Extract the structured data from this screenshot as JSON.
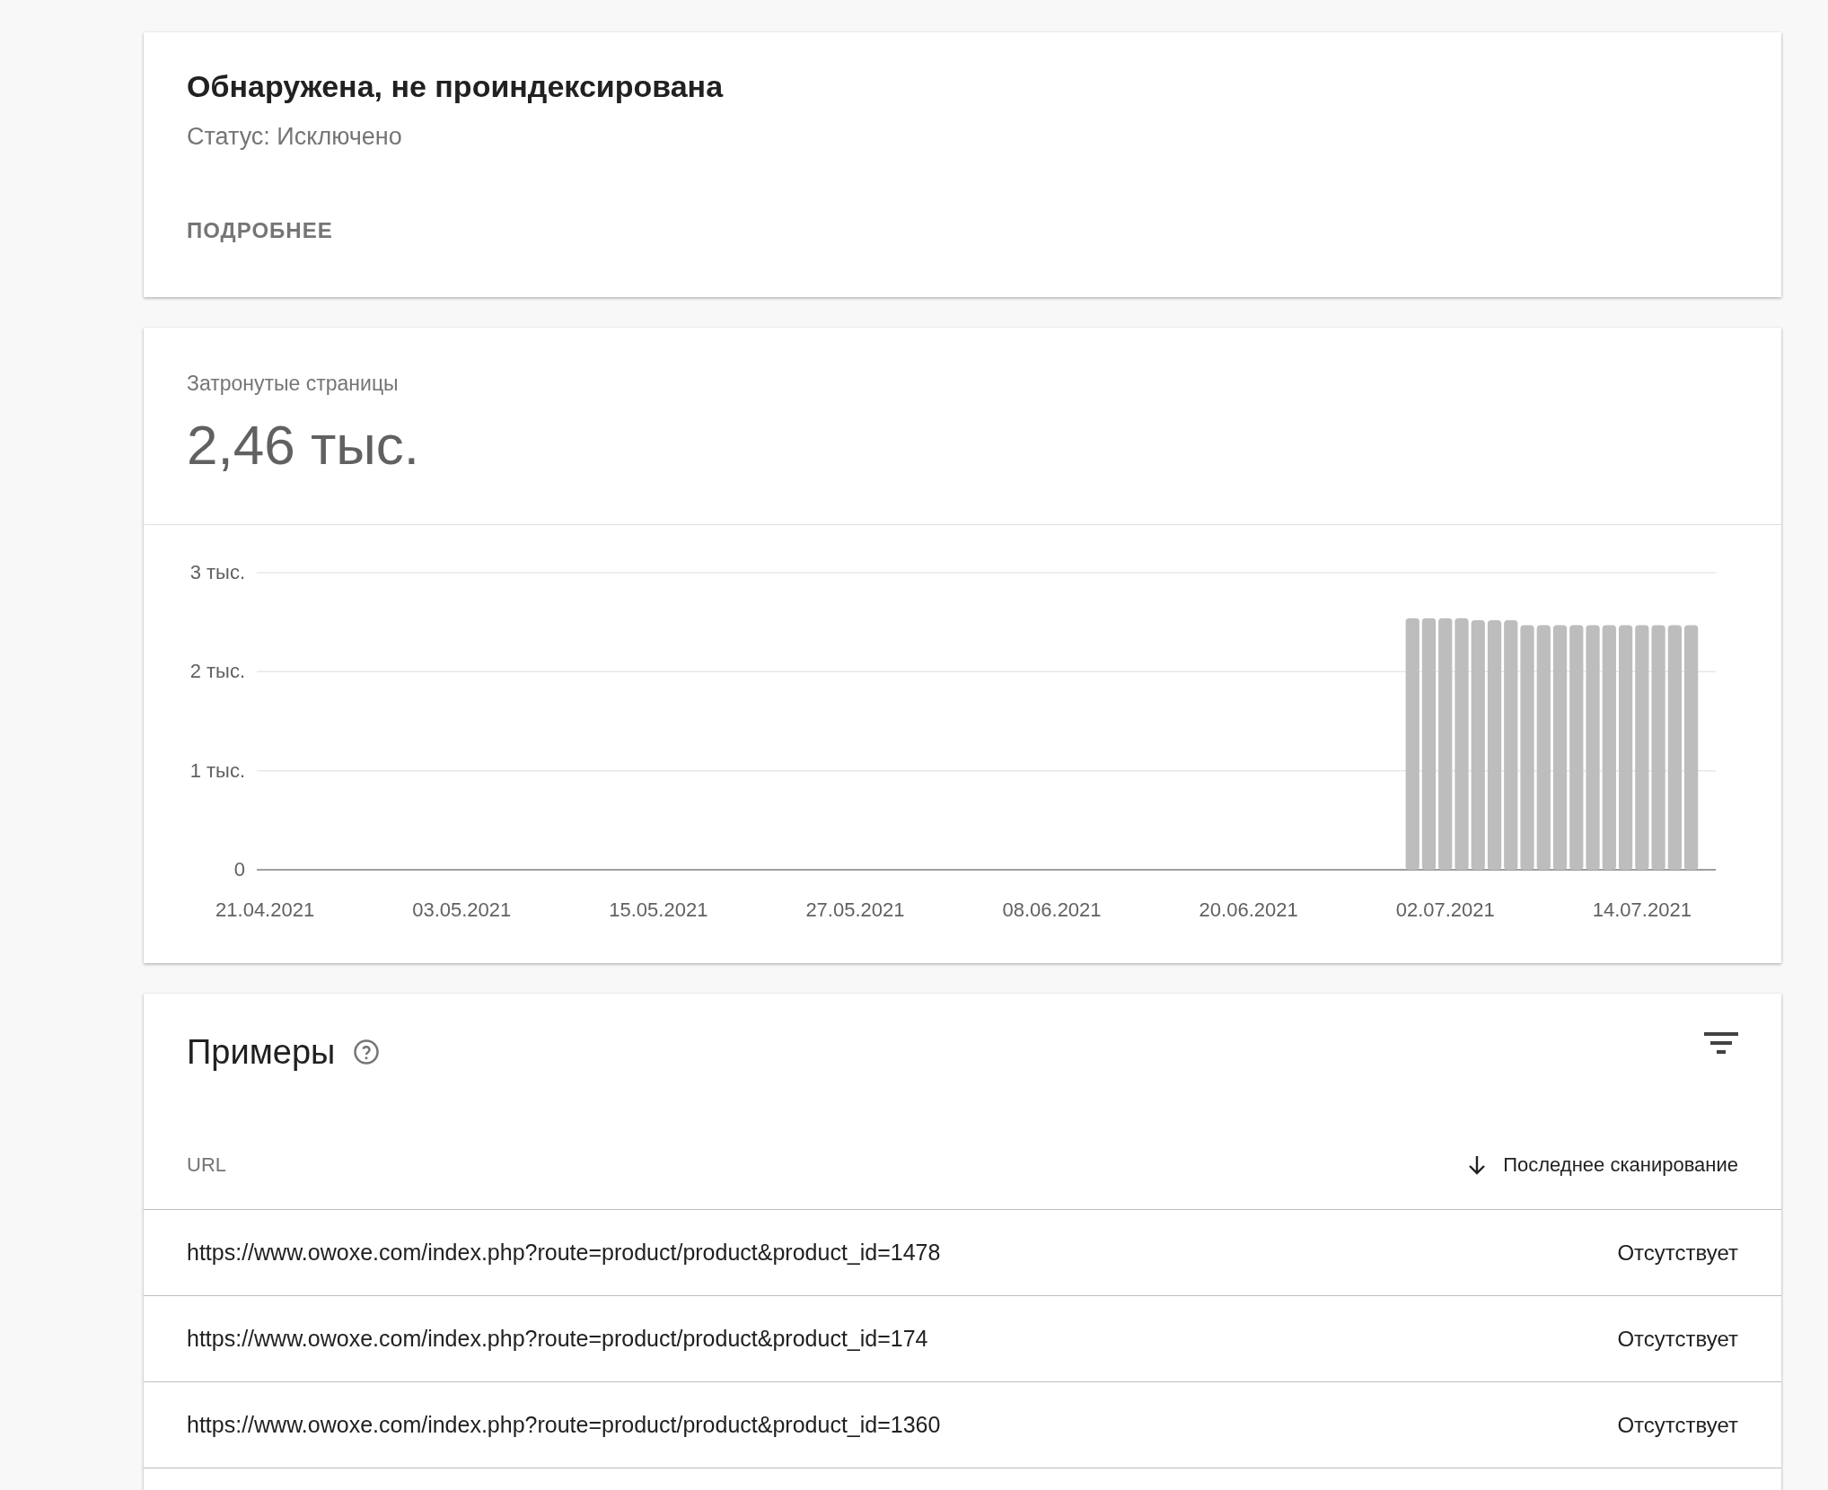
{
  "summary": {
    "title": "Обнаружена, не проиндексирована",
    "status": "Статус: Исключено",
    "details_button": "ПОДРОБНЕЕ"
  },
  "affected": {
    "label": "Затронутые страницы",
    "value": "2,46 тыс.",
    "chart_data": {
      "type": "bar",
      "categories": [
        "21.04.2021",
        null,
        null,
        null,
        null,
        null,
        null,
        null,
        null,
        null,
        null,
        null,
        "03.05.2021",
        null,
        null,
        null,
        null,
        null,
        null,
        null,
        null,
        null,
        null,
        null,
        "15.05.2021",
        null,
        null,
        null,
        null,
        null,
        null,
        null,
        null,
        null,
        null,
        null,
        "27.05.2021",
        null,
        null,
        null,
        null,
        null,
        null,
        null,
        null,
        null,
        null,
        null,
        "08.06.2021",
        null,
        null,
        null,
        null,
        null,
        null,
        null,
        null,
        null,
        null,
        null,
        "20.06.2021",
        null,
        null,
        null,
        null,
        null,
        null,
        null,
        null,
        null,
        null,
        null,
        "02.07.2021",
        null,
        null,
        null,
        null,
        null,
        null,
        null,
        null,
        null,
        null,
        null,
        "14.07.2021",
        null,
        null,
        null,
        null
      ],
      "series": [
        {
          "color": "#bdbdbd",
          "values": [
            null,
            null,
            null,
            null,
            null,
            null,
            null,
            null,
            null,
            null,
            null,
            null,
            null,
            null,
            null,
            null,
            null,
            null,
            null,
            null,
            null,
            null,
            null,
            null,
            null,
            null,
            null,
            null,
            null,
            null,
            null,
            null,
            null,
            null,
            null,
            null,
            null,
            null,
            null,
            null,
            null,
            null,
            null,
            null,
            null,
            null,
            null,
            null,
            null,
            null,
            null,
            null,
            null,
            null,
            null,
            null,
            null,
            null,
            null,
            null,
            null,
            null,
            null,
            null,
            null,
            null,
            null,
            null,
            null,
            null,
            2.54,
            2.54,
            2.54,
            2.54,
            2.52,
            2.52,
            2.52,
            2.47,
            2.47,
            2.47,
            2.47,
            2.47,
            2.47,
            2.47,
            2.47,
            2.47,
            2.47,
            2.47,
            null
          ]
        }
      ],
      "ylim": [
        0,
        3
      ],
      "yticks": [
        {
          "value": 0,
          "label": "0"
        },
        {
          "value": 1,
          "label": "1 тыс."
        },
        {
          "value": 2,
          "label": "2 тыс."
        },
        {
          "value": 3,
          "label": "3 тыс."
        }
      ]
    }
  },
  "examples": {
    "title": "Примеры",
    "columns": [
      {
        "label": "URL",
        "sorted": false
      },
      {
        "label": "Последнее сканирование",
        "sorted": true
      }
    ],
    "rows": [
      {
        "url": "https://www.owoxe.com/index.php?route=product/product&product_id=1478",
        "last_crawl": "Отсутствует"
      },
      {
        "url": "https://www.owoxe.com/index.php?route=product/product&product_id=174",
        "last_crawl": "Отсутствует"
      },
      {
        "url": "https://www.owoxe.com/index.php?route=product/product&product_id=1360",
        "last_crawl": "Отсутствует"
      }
    ]
  }
}
